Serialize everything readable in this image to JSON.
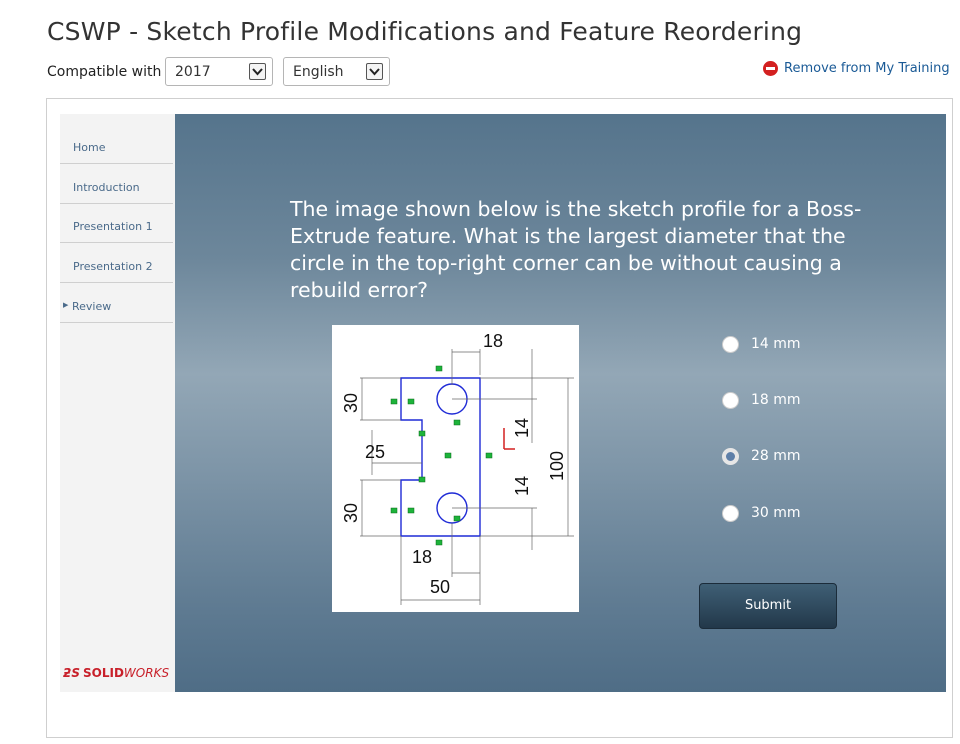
{
  "page_title": "CSWP - Sketch Profile Modifications and Feature Reordering",
  "compatibility": {
    "label": "Compatible with",
    "version_value": "2017",
    "language_value": "English"
  },
  "remove_link": "Remove from My Training",
  "sidebar": {
    "items": [
      {
        "label": "Home"
      },
      {
        "label": "Introduction"
      },
      {
        "label": "Presentation 1"
      },
      {
        "label": "Presentation 2"
      },
      {
        "label": "Review",
        "current": true
      }
    ],
    "logo": {
      "prefix": "SOLID",
      "suffix": "WORKS"
    }
  },
  "question": {
    "text": "The image shown below is the sketch profile for a Boss-Extrude feature. What is the largest diameter that the circle in the top-right corner can be without causing a rebuild error?",
    "sketch_dimensions": [
      "18",
      "30",
      "25",
      "14",
      "100",
      "14",
      "30",
      "18",
      "50"
    ]
  },
  "answers": [
    {
      "label": "14 mm",
      "selected": false
    },
    {
      "label": "18 mm",
      "selected": false
    },
    {
      "label": "28 mm",
      "selected": true
    },
    {
      "label": "30 mm",
      "selected": false
    }
  ],
  "submit_label": "Submit",
  "colors": {
    "link": "#1a5a96",
    "nav_text": "#4a6a8a",
    "sketch_line": "#1f2bd6",
    "constraint": "#1db33a",
    "brand_red": "#c8202a"
  }
}
